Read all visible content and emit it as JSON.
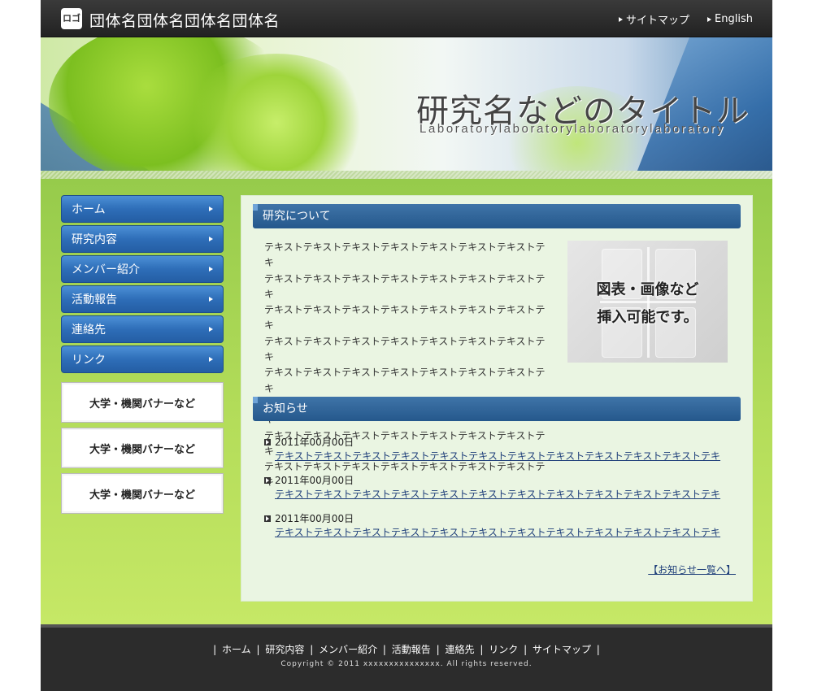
{
  "header": {
    "logo_label": "ロゴ",
    "org_name": "団体名団体名団体名団体名",
    "links": [
      "サイトマップ",
      "English"
    ]
  },
  "hero": {
    "title": "研究名などのタイトル",
    "subtitle": "Laboratorylaboratorylaboratorylaboratory"
  },
  "nav": {
    "items": [
      "ホーム",
      "研究内容",
      "メンバー紹介",
      "活動報告",
      "連絡先",
      "リンク"
    ]
  },
  "banners": [
    "大学・機関バナーなど",
    "大学・機関バナーなど",
    "大学・機関バナーなど"
  ],
  "about": {
    "heading": "研究について",
    "lines": [
      "テキストテキストテキストテキストテキストテキストテキストテキ",
      "テキストテキストテキストテキストテキストテキストテキストテキ",
      "テキストテキストテキストテキストテキストテキストテキストテキ",
      "テキストテキストテキストテキストテキストテキストテキストテキ",
      "テキストテキストテキストテキストテキストテキストテキストテキ",
      "テキストテキストテキストテキストテキストテキストテキストテキ",
      "テキストテキストテキストテキストテキストテキストテキストテキ",
      "テキストテキストテキストテキストテキストテキストテキストテキ"
    ],
    "image_line1": "図表・画像など",
    "image_line2": "挿入可能です。"
  },
  "news": {
    "heading": "お知らせ",
    "items": [
      {
        "date": "2011年00月00日",
        "text": "テキストテキストテキストテキストテキストテキストテキストテキストテキストテキストテキストテキ"
      },
      {
        "date": "2011年00月00日",
        "text": "テキストテキストテキストテキストテキストテキストテキストテキストテキストテキストテキストテキ"
      },
      {
        "date": "2011年00月00日",
        "text": "テキストテキストテキストテキストテキストテキストテキストテキストテキストテキストテキストテキ"
      }
    ],
    "more": "【お知らせ一覧へ】"
  },
  "footer": {
    "links": [
      "ホーム",
      "研究内容",
      "メンバー紹介",
      "活動報告",
      "連絡先",
      "リンク",
      "サイトマップ"
    ],
    "copyright": "Copyright © 2011 xxxxxxxxxxxxxxx. All rights reserved."
  },
  "colors": {
    "nav_blue": "#2e6eb8",
    "section_header": "#25588c",
    "content_bg": "#eaf5e2",
    "footer_bg": "#2c2c2c",
    "link": "#1f3f7a"
  }
}
